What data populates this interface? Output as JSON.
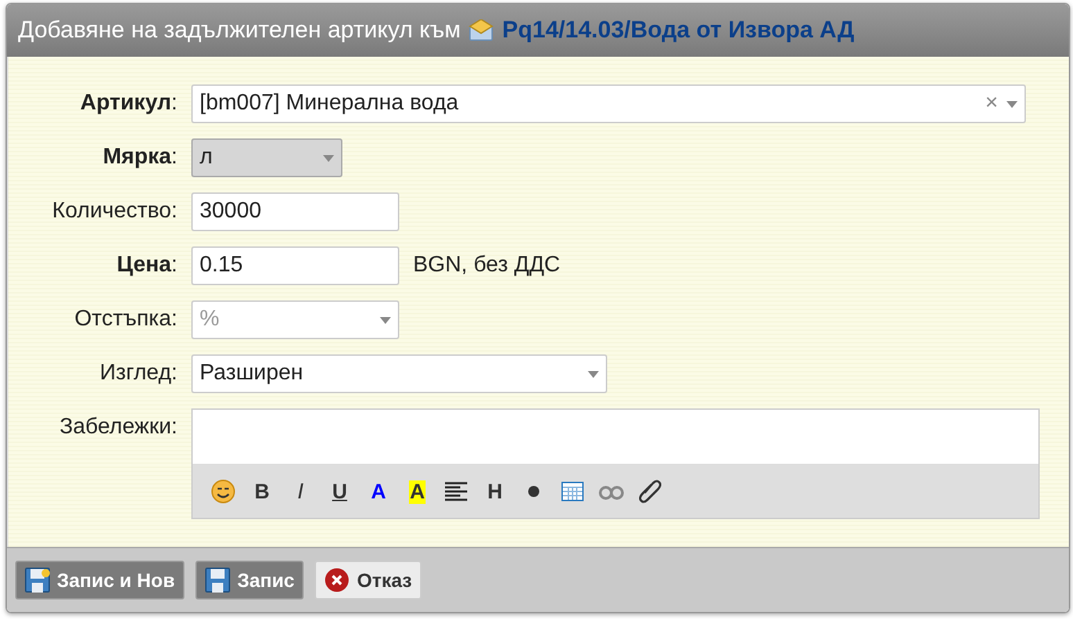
{
  "window": {
    "title": "Добавяне на задължителен артикул към",
    "link": "Pq14/14.03/Вода от Извора АД"
  },
  "fields": [
    {
      "kind": "combo",
      "label": "**Артикул**:",
      "value": "[bm007] Минерална вода",
      "clear": "×"
    },
    {
      "kind": "select",
      "label": "**Мярка**:",
      "value": "л",
      "disabled": true
    },
    {
      "kind": "input",
      "label": "Количество:",
      "value": "30000"
    },
    {
      "kind": "input",
      "label": "**Цена**:",
      "value": "0.15",
      "suffix": "BGN, без ДДС"
    },
    {
      "kind": "select",
      "label": "Отстъпка:",
      "placeholder": "%"
    },
    {
      "kind": "wide-select",
      "label": "Изглед:",
      "value": "Разширен"
    },
    {
      "kind": "editor",
      "label": "Забележки:"
    }
  ],
  "toolbar": [
    {
      "kind": "smiley"
    },
    {
      "kind": "bold",
      "label": "B"
    },
    {
      "kind": "italic",
      "label": "I"
    },
    {
      "kind": "underline",
      "label": "U"
    },
    {
      "kind": "color",
      "label": "A"
    },
    {
      "kind": "highlight",
      "label": "A"
    },
    {
      "kind": "align"
    },
    {
      "kind": "heading",
      "label": "H"
    },
    {
      "kind": "bullet"
    },
    {
      "kind": "table"
    },
    {
      "kind": "quote"
    },
    {
      "kind": "attach"
    }
  ],
  "buttons": [
    {
      "kind": "save-new",
      "label": "Запис и Нов"
    },
    {
      "kind": "save",
      "label": "Запис"
    },
    {
      "kind": "cancel",
      "label": "Отказ"
    }
  ]
}
